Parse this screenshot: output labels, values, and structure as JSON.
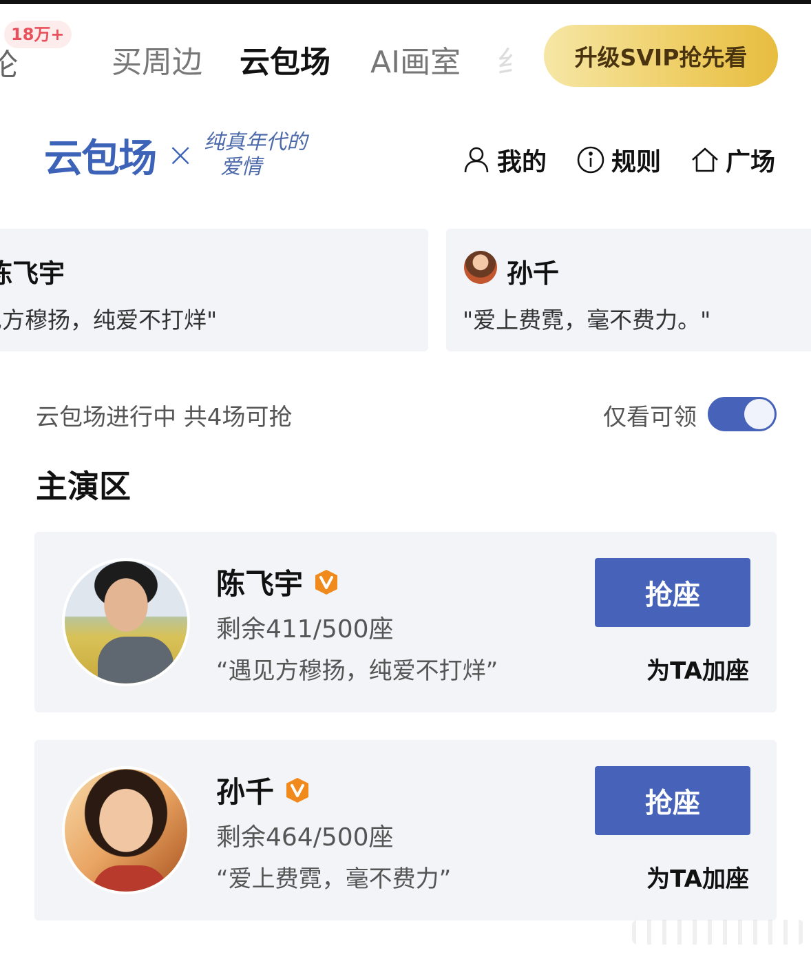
{
  "tabs": {
    "cut_left": "论",
    "badge": "18万+",
    "items": [
      "买周边",
      "云包场",
      "AI画室"
    ],
    "cut_right": "纟",
    "svip_button": "升级SVIP抢先看"
  },
  "brand": {
    "logo_text": "云包场",
    "x": "×",
    "drama_line1": "纯真年代的",
    "drama_line2": "爱情"
  },
  "nav": {
    "mine": "我的",
    "rules": "规则",
    "plaza": "广场",
    "icons": [
      "person-icon",
      "info-icon",
      "home-icon"
    ]
  },
  "carousel": [
    {
      "name": "陈飞宇",
      "quote": "见方穆扬，纯爱不打烊\""
    },
    {
      "name": "孙千",
      "quote": "\"爱上费霓，毫不费力。\""
    }
  ],
  "status": {
    "text": "云包场进行中 共4场可抢",
    "filter_label": "仅看可领",
    "filter_on": true
  },
  "section_title": "主演区",
  "actors": [
    {
      "name": "陈飞宇",
      "seats": "剩余411/500座",
      "remaining": 411,
      "total": 500,
      "quote": "“遇见方穆扬，纯爱不打烊”",
      "grab": "抢座",
      "add_seat": "为TA加座"
    },
    {
      "name": "孙千",
      "seats": "剩余464/500座",
      "remaining": 464,
      "total": 500,
      "quote": "“爱上费霓，毫不费力”",
      "grab": "抢座",
      "add_seat": "为TA加座"
    }
  ],
  "colors": {
    "accent": "#4763b9",
    "brand_blue": "#3d63b8",
    "badge_red": "#e8505b",
    "verified_orange": "#f08a1c",
    "card_bg": "#f3f4f8"
  }
}
